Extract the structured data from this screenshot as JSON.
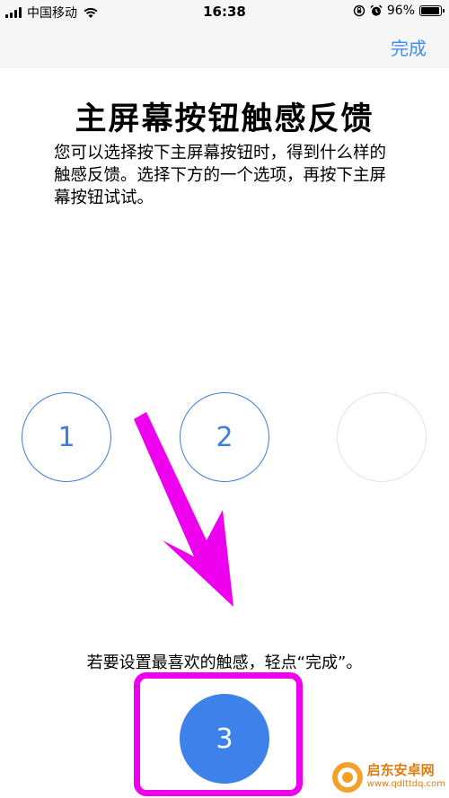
{
  "status_bar": {
    "carrier": "中国移动",
    "time": "16:38",
    "battery": "96%",
    "battery_level": 0.96,
    "icons": [
      "signal-icon",
      "wifi-icon",
      "orientation-lock-icon",
      "alarm-icon",
      "battery-icon"
    ]
  },
  "nav": {
    "done_label": "完成"
  },
  "page": {
    "title": "主屏幕按钮触感反馈",
    "description": "您可以选择按下主屏幕按钮时，得到什么样的触感反馈。选择下方的一个选项，再按下主屏幕按钮试试。",
    "hint": "若要设置最喜欢的触感，轻点“完成”。"
  },
  "options": [
    {
      "label": "1"
    },
    {
      "label": "2"
    },
    {
      "label": ""
    }
  ],
  "home_button": {
    "label": "3"
  },
  "annotation": {
    "color": "#ee00ee"
  },
  "watermark": {
    "name": "启东安卓网",
    "url": "www.qdlttdq.com"
  },
  "colors": {
    "accent": "#3d8ff0",
    "option_border": "#3d7fdc",
    "home_button": "#3f81ea",
    "bar_background": "#f6f6f7"
  }
}
